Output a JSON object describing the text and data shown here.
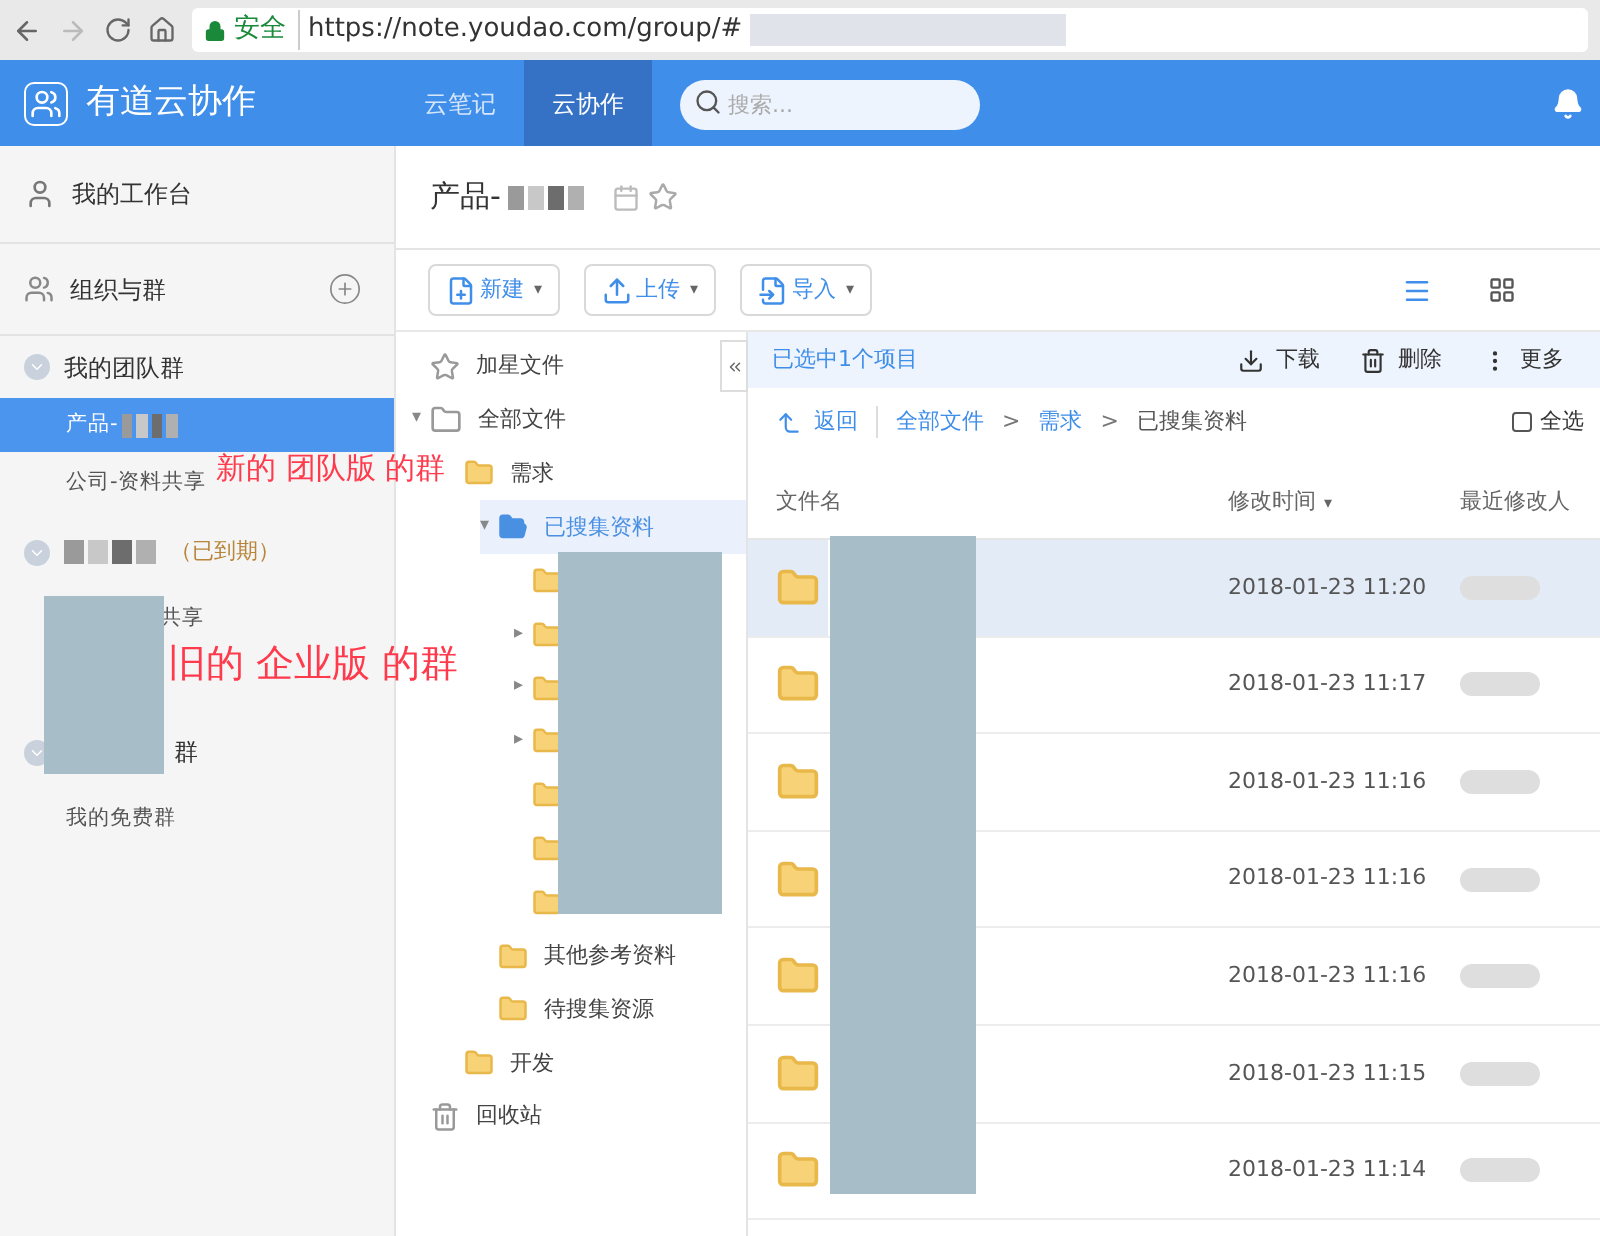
{
  "browser": {
    "security": "安全",
    "url": "https://note.youdao.com/group/#"
  },
  "app": {
    "title": "有道云协作",
    "search": {
      "placeholder": "搜索..."
    },
    "tabs": [
      {
        "label": "云笔记",
        "selected": false
      },
      {
        "label": "云协作",
        "selected": true
      }
    ]
  },
  "sidebar": {
    "workbench": "我的工作台",
    "orgs": "组织与群",
    "sections": [
      {
        "title": "我的团队群",
        "items": [
          {
            "label": "产品-",
            "selected": true
          },
          {
            "label": "公司-资料共享",
            "selected": false
          }
        ]
      },
      {
        "status": "（已到期）",
        "title_obscured": true,
        "items": [
          {
            "label": "共享",
            "selected": false,
            "covered": true
          }
        ]
      },
      {
        "title": "群",
        "title_covered": true,
        "items": [
          {
            "label": "我的免费群",
            "selected": false
          }
        ]
      }
    ]
  },
  "annotations": [
    {
      "text": "新的 团队版 的群"
    },
    {
      "text": "旧的 企业版 的群"
    }
  ],
  "page": {
    "title": "产品-",
    "toolbar": [
      {
        "label": "新建",
        "caret": "▾"
      },
      {
        "label": "上传",
        "caret": "▾"
      },
      {
        "label": "导入",
        "caret": "▾"
      }
    ],
    "list_view_selected": true
  },
  "tree": [
    {
      "kind": "starred",
      "label": "加星文件",
      "selected": false
    },
    {
      "kind": "root",
      "label": "全部文件",
      "selected": false,
      "caret": "▾",
      "children": [
        {
          "kind": "folder",
          "label": "需求",
          "selected": false,
          "children": [
            {
              "kind": "folder",
              "label": "已搜集资料",
              "selected": true,
              "caret": "▾",
              "children": [
                {
                  "kind": "folder",
                  "selected": false
                },
                {
                  "kind": "folder",
                  "selected": false,
                  "caret": "▸"
                },
                {
                  "kind": "folder",
                  "selected": false,
                  "caret": "▸"
                },
                {
                  "kind": "folder",
                  "selected": false,
                  "caret": "▸"
                },
                {
                  "kind": "folder",
                  "selected": false
                },
                {
                  "kind": "folder",
                  "selected": false
                },
                {
                  "kind": "folder",
                  "selected": false
                }
              ]
            },
            {
              "kind": "folder",
              "label": "其他参考资料",
              "selected": false
            },
            {
              "kind": "folder",
              "label": "待搜集资源",
              "selected": false
            }
          ]
        },
        {
          "kind": "folder",
          "label": "开发",
          "selected": false
        }
      ]
    },
    {
      "kind": "trash",
      "label": "回收站",
      "selected": false
    }
  ],
  "selection_bar": {
    "text": "已选中1个项目",
    "actions": [
      {
        "kind": "download",
        "label": "下载"
      },
      {
        "kind": "delete",
        "label": "删除"
      },
      {
        "kind": "more",
        "label": "更多"
      }
    ]
  },
  "breadcrumb": {
    "back": "返回",
    "path": [
      {
        "label": "全部文件",
        "link": true
      },
      {
        "label": "需求",
        "link": true
      },
      {
        "label": "已搜集资料",
        "link": false
      }
    ],
    "separator": ">",
    "select_all": {
      "label": "全选",
      "checked": false
    }
  },
  "table": {
    "columns": [
      {
        "label": "文件名"
      },
      {
        "label": "修改时间",
        "sort": "▾"
      },
      {
        "label": "最近修改人"
      }
    ],
    "rows": [
      {
        "modified": "2018-01-23 11:20",
        "selected": true
      },
      {
        "modified": "2018-01-23 11:17",
        "selected": false
      },
      {
        "modified": "2018-01-23 11:16",
        "selected": false
      },
      {
        "modified": "2018-01-23 11:16",
        "selected": false
      },
      {
        "modified": "2018-01-23 11:16",
        "selected": false
      },
      {
        "modified": "2018-01-23 11:15",
        "selected": false
      },
      {
        "modified": "2018-01-23 11:14",
        "selected": false
      }
    ]
  }
}
